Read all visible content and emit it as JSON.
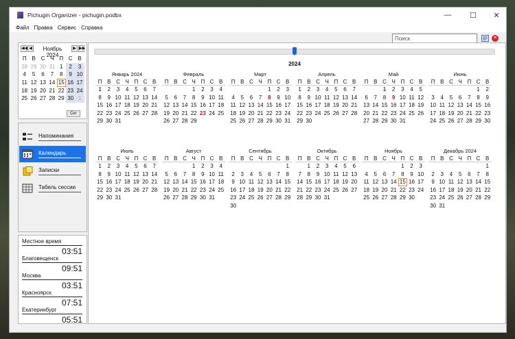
{
  "window": {
    "title": "Pichugin Organizer - pichugin.podbx"
  },
  "menu": [
    "Файл",
    "Правка",
    "Сервис",
    "Справка"
  ],
  "search": {
    "placeholder": "Поиск"
  },
  "mini_calendar": {
    "title": "Ноябрь 2024",
    "weekdays": [
      "П",
      "В",
      "С",
      "Ч",
      "П",
      "С",
      "В"
    ],
    "weeks": [
      [
        [
          "28",
          1
        ],
        [
          "29",
          1
        ],
        [
          "30",
          1
        ],
        [
          "31",
          1
        ],
        [
          "1",
          0
        ],
        [
          "2",
          0
        ],
        [
          "3",
          0
        ]
      ],
      [
        [
          "4",
          0
        ],
        [
          "5",
          0
        ],
        [
          "6",
          0
        ],
        [
          "7",
          0
        ],
        [
          "8",
          0
        ],
        [
          "9",
          0
        ],
        [
          "10",
          0
        ]
      ],
      [
        [
          "11",
          0
        ],
        [
          "12",
          0
        ],
        [
          "13",
          0
        ],
        [
          "14",
          0
        ],
        [
          "15",
          2
        ],
        [
          "16",
          0
        ],
        [
          "17",
          0
        ]
      ],
      [
        [
          "18",
          0
        ],
        [
          "19",
          0
        ],
        [
          "20",
          0
        ],
        [
          "21",
          0
        ],
        [
          "22",
          0
        ],
        [
          "23",
          0
        ],
        [
          "24",
          0
        ]
      ],
      [
        [
          "25",
          0
        ],
        [
          "26",
          0
        ],
        [
          "27",
          0
        ],
        [
          "28",
          0
        ],
        [
          "29",
          0
        ],
        [
          "30",
          0
        ],
        [
          "1",
          1
        ]
      ]
    ],
    "today_button": "Сег"
  },
  "nav": [
    {
      "label": "Напоминания",
      "icon": "reminders-icon",
      "active": false
    },
    {
      "label": "Календарь",
      "icon": "calendar-icon",
      "active": true
    },
    {
      "label": "Записки",
      "icon": "notes-icon",
      "active": false
    },
    {
      "label": "Табель сессии",
      "icon": "timesheet-icon",
      "active": false
    }
  ],
  "clocks": [
    {
      "city": "Местное время",
      "time": "03:51"
    },
    {
      "city": "Благовещенск",
      "time": "09:51"
    },
    {
      "city": "Москва",
      "time": "03:51"
    },
    {
      "city": "Красноярск",
      "time": "07:51"
    },
    {
      "city": "Екатеринбург",
      "time": "05:51"
    }
  ],
  "year": {
    "label": "2024",
    "slider_position": 0.5
  },
  "months": [
    {
      "title": "Январь 2024",
      "offset": 0,
      "days": 31,
      "holidays": [
        1
      ]
    },
    {
      "title": "Февраль",
      "offset": 3,
      "days": 29,
      "holidays": [
        23
      ]
    },
    {
      "title": "Март",
      "offset": 4,
      "days": 31,
      "holidays": [
        8
      ]
    },
    {
      "title": "Апрель",
      "offset": 0,
      "days": 30,
      "holidays": []
    },
    {
      "title": "Май",
      "offset": 2,
      "days": 31,
      "holidays": [
        1,
        9
      ]
    },
    {
      "title": "Июнь",
      "offset": 5,
      "days": 30,
      "holidays": []
    },
    {
      "title": "Июль",
      "offset": 0,
      "days": 31,
      "holidays": []
    },
    {
      "title": "Август",
      "offset": 3,
      "days": 31,
      "holidays": []
    },
    {
      "title": "Сентябрь",
      "offset": 6,
      "days": 30,
      "holidays": []
    },
    {
      "title": "Октябрь",
      "offset": 1,
      "days": 31,
      "holidays": []
    },
    {
      "title": "Ноябрь",
      "offset": 4,
      "days": 30,
      "holidays": [],
      "today": 15
    },
    {
      "title": "Декабрь 2024",
      "offset": 6,
      "days": 31,
      "holidays": []
    }
  ]
}
